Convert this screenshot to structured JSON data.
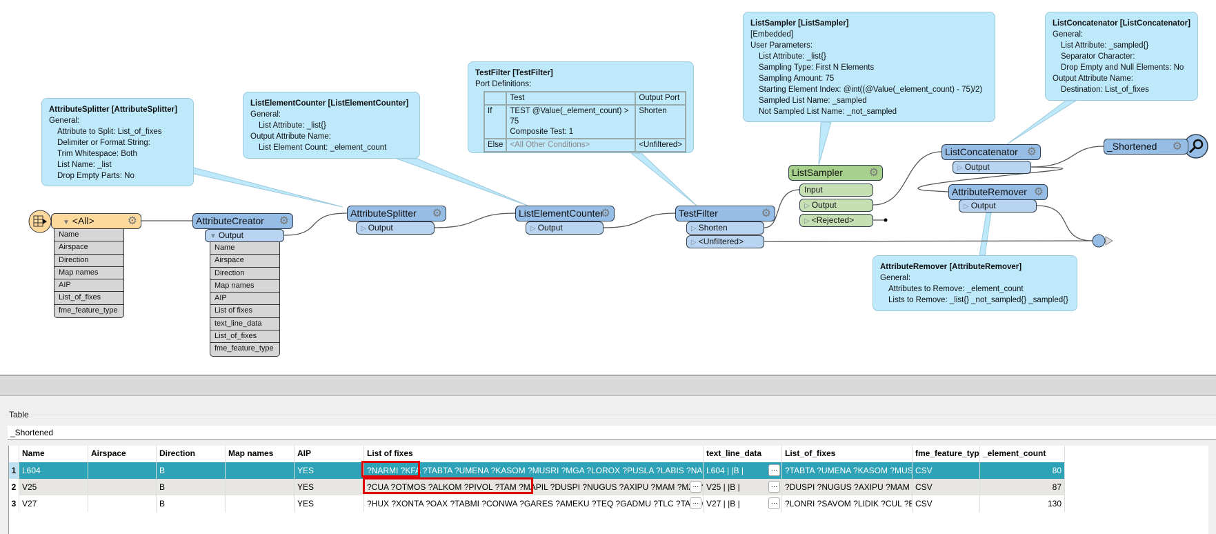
{
  "annotations": [
    {
      "id": "attributesplitter",
      "title": "AttributeSplitter [AttributeSplitter]",
      "lines": [
        {
          "text": "General:",
          "level": 0
        },
        {
          "text": "Attribute to Split: List_of_fixes",
          "level": 1
        },
        {
          "text": "Delimiter or Format String:",
          "level": 1
        },
        {
          "text": "Trim Whitespace: Both",
          "level": 1
        },
        {
          "text": "List Name: _list",
          "level": 1
        },
        {
          "text": "Drop Empty Parts: No",
          "level": 1
        }
      ]
    },
    {
      "id": "listelementcounter",
      "title": "ListElementCounter [ListElementCounter]",
      "lines": [
        {
          "text": "General:",
          "level": 0
        },
        {
          "text": "List Attribute: _list{}",
          "level": 1
        },
        {
          "text": "Output Attribute Name:",
          "level": 0
        },
        {
          "text": "List Element Count: _element_count",
          "level": 1
        }
      ]
    },
    {
      "id": "listsampler",
      "title": "ListSampler [ListSampler]",
      "lines": [
        {
          "text": "[Embedded]",
          "level": 0
        },
        {
          "text": "User Parameters:",
          "level": 0
        },
        {
          "text": "List Attribute: _list{}",
          "level": 1
        },
        {
          "text": "Sampling Type: First N Elements",
          "level": 1
        },
        {
          "text": "Sampling Amount: 75",
          "level": 1
        },
        {
          "text": "Starting Element Index: @int((@Value(_element_count) - 75)/2)",
          "level": 1
        },
        {
          "text": "Sampled List Name: _sampled",
          "level": 1
        },
        {
          "text": "Not Sampled List Name: _not_sampled",
          "level": 1
        }
      ]
    },
    {
      "id": "listconcatenator",
      "title": "ListConcatenator [ListConcatenator]",
      "lines": [
        {
          "text": "General:",
          "level": 0
        },
        {
          "text": "List Attribute: _sampled{}",
          "level": 1
        },
        {
          "text": "Separator Character:",
          "level": 1
        },
        {
          "text": "Drop Empty and Null Elements: No",
          "level": 1
        },
        {
          "text": "Output Attribute Name:",
          "level": 0
        },
        {
          "text": "Destination: List_of_fixes",
          "level": 1
        }
      ]
    },
    {
      "id": "attributeremover",
      "title": "AttributeRemover [AttributeRemover]",
      "lines": [
        {
          "text": "General:",
          "level": 0
        },
        {
          "text": "Attributes to Remove: _element_count",
          "level": 1
        },
        {
          "text": "Lists to Remove: _list{} _not_sampled{} _sampled{}",
          "level": 1
        }
      ]
    }
  ],
  "testfilter_annotation": {
    "title": "TestFilter [TestFilter]",
    "subtitle": "Port Definitions:",
    "headers": [
      "",
      "Test",
      "Output Port"
    ],
    "rows": [
      [
        "If",
        "TEST @Value(_element_count) > 75",
        "Composite Test: 1",
        "Shorten"
      ],
      [
        "Else",
        "<All Other Conditions>",
        "",
        "<Unfiltered>"
      ]
    ]
  },
  "nodes": {
    "reader": {
      "label": "<All>",
      "attributes": [
        "Name",
        "Airspace",
        "Direction",
        "Map names",
        "AIP",
        "List_of_fixes",
        "fme_feature_type"
      ]
    },
    "attributecreator": {
      "label": "AttributeCreator",
      "port": "Output",
      "attributes": [
        "Name",
        "Airspace",
        "Direction",
        "Map names",
        "AIP",
        "List of fixes",
        "text_line_data",
        "List_of_fixes",
        "fme_feature_type"
      ]
    },
    "attributesplitter": {
      "label": "AttributeSplitter",
      "port": "Output"
    },
    "listelementcounter": {
      "label": "ListElementCounter",
      "port": "Output"
    },
    "testfilter": {
      "label": "TestFilter",
      "ports": [
        "Shorten",
        "<Unfiltered>"
      ]
    },
    "listsampler": {
      "label": "ListSampler",
      "ports": [
        "Input",
        "Output",
        "<Rejected>"
      ]
    },
    "listconcatenator": {
      "label": "ListConcatenator",
      "port": "Output"
    },
    "attributeremover": {
      "label": "AttributeRemover",
      "port": "Output"
    },
    "inspector": {
      "label": "_Shortened"
    }
  },
  "panel": {
    "group_label": "Table",
    "feature_type": "_Shortened",
    "columns": [
      "Name",
      "Airspace",
      "Direction",
      "Map names",
      "AIP",
      "List of fixes",
      "text_line_data",
      "List_of_fixes",
      "fme_feature_typ",
      "_element_count"
    ],
    "rows": [
      {
        "n": "1",
        "cells": [
          "L604",
          "",
          "B",
          "",
          "YES",
          "?NARMI ?KFA ?TABTA ?UMENA ?KASOM ?MUSRI ?MGA ?LOROX ?PUSLA ?LABIS ?NAGSA ?...",
          "L604  |     |B     |",
          "?TABTA ?UMENA ?KASOM ?MUS...",
          "CSV",
          "80"
        ]
      },
      {
        "n": "2",
        "cells": [
          "V25",
          "",
          "B",
          "",
          "YES",
          "?CUA ?OTMOS ?ALKOM ?PIVOL ?TAM ?MAPIL ?DUSPI ?NUGUS ?AXIPU ?MAM ?MZB ?RED",
          "V25   |     |B     |",
          "?DUSPI ?NUGUS ?AXIPU ?MAM ?...",
          "CSV",
          "87"
        ]
      },
      {
        "n": "3",
        "cells": [
          "V27",
          "",
          "B",
          "",
          "YES",
          "?HUX ?XONTA ?OAX ?TABMI ?CONWA ?GARES ?AMEKU ?TEQ ?GADMU ?TLC ?TAKUG ?AN",
          "V27   |     |B     |",
          "?LONRI ?SAVOM ?LIDIK ?CUL ?EV...",
          "CSV",
          "130"
        ]
      }
    ],
    "ellipsis": "...",
    "selected_row": 1,
    "colors": {
      "selected": "#2ea3b8",
      "highlight_box": "#e00000"
    }
  },
  "colors": {
    "transformer": "#95bde6",
    "port": "#b8d4f0",
    "listsampler": "#a8d08d",
    "reader": "#fdd99b",
    "annotation": "#bde9fb"
  }
}
